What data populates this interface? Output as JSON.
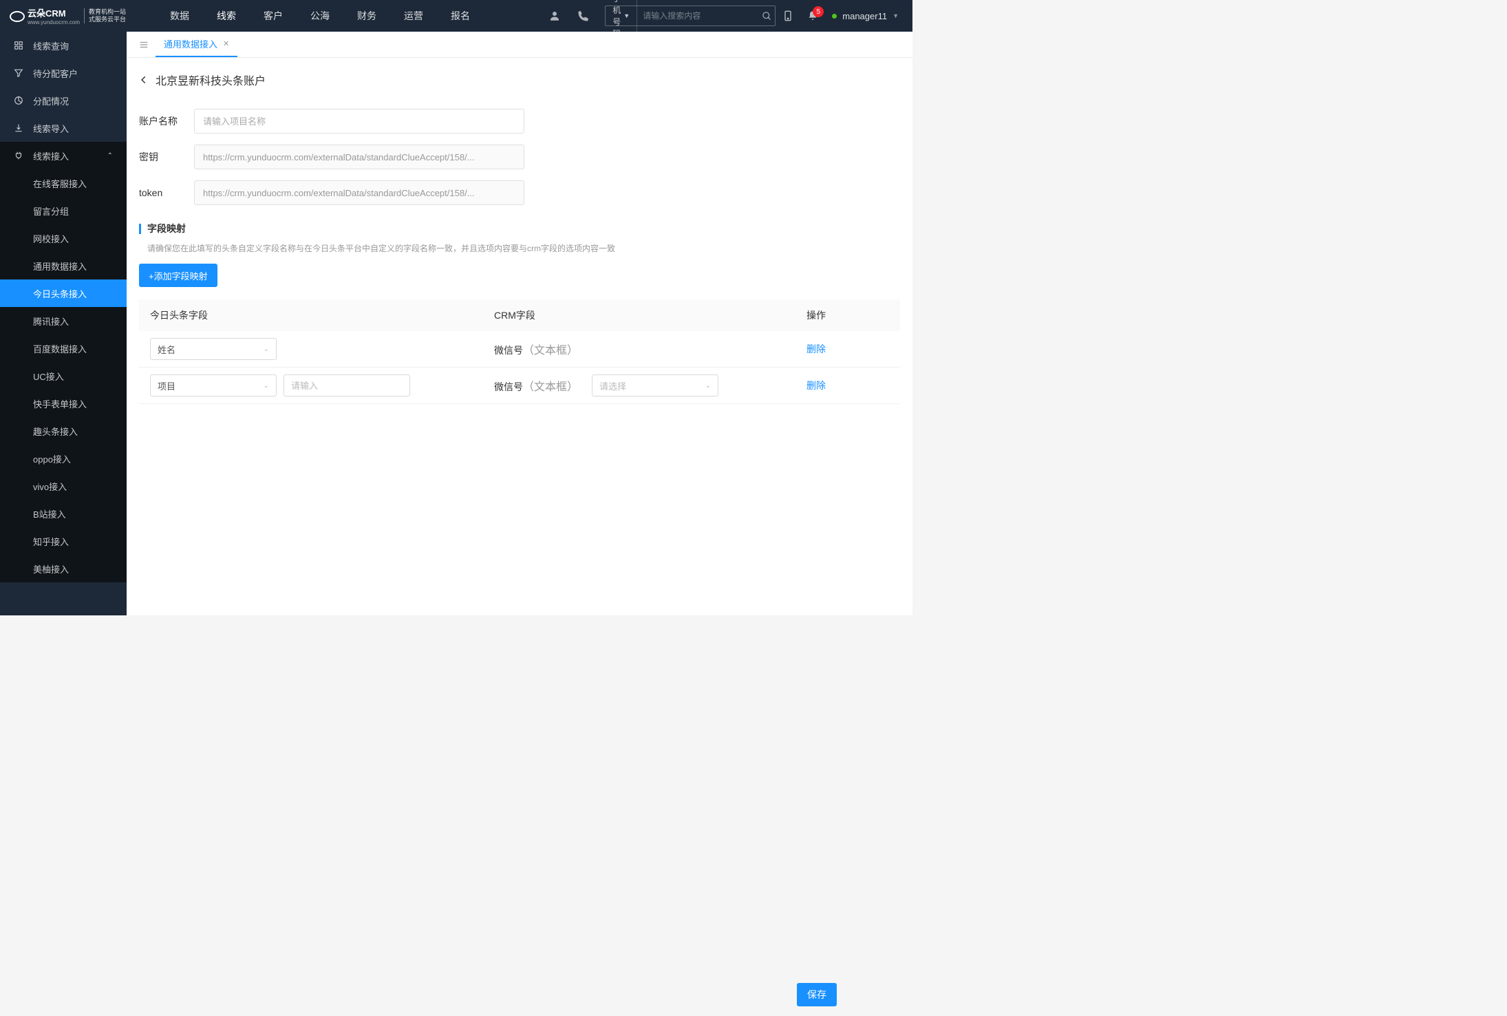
{
  "logo": {
    "brand": "云朵CRM",
    "subtitle1": "教育机构一站",
    "subtitle2": "式服务云平台",
    "url": "www.yunduocrm.com"
  },
  "topnav": [
    "数据",
    "线索",
    "客户",
    "公海",
    "财务",
    "运营",
    "报名"
  ],
  "topnav_active": 1,
  "search": {
    "selector": "手机号码",
    "placeholder": "请输入搜索内容"
  },
  "notifications": {
    "count": "5"
  },
  "user": {
    "name": "manager11"
  },
  "sidebar": {
    "items": [
      {
        "icon": "grid",
        "label": "线索查询"
      },
      {
        "icon": "filter",
        "label": "待分配客户"
      },
      {
        "icon": "pie",
        "label": "分配情况"
      },
      {
        "icon": "export",
        "label": "线索导入"
      }
    ],
    "expanded": {
      "icon": "plug",
      "label": "线索接入"
    },
    "subitems": [
      "在线客服接入",
      "留言分组",
      "网校接入",
      "通用数据接入",
      "今日头条接入",
      "腾讯接入",
      "百度数据接入",
      "UC接入",
      "快手表单接入",
      "趣头条接入",
      "oppo接入",
      "vivo接入",
      "B站接入",
      "知乎接入",
      "美柚接入"
    ],
    "active_sub": 4
  },
  "tab": {
    "label": "通用数据接入"
  },
  "page": {
    "title": "北京昱新科技头条账户"
  },
  "form": {
    "account_label": "账户名称",
    "account_placeholder": "请输入项目名称",
    "secret_label": "密钥",
    "secret_value": "https://crm.yunduocrm.com/externalData/standardClueAccept/158/...",
    "token_label": "token",
    "token_value": "https://crm.yunduocrm.com/externalData/standardClueAccept/158/..."
  },
  "mapping": {
    "title": "字段映射",
    "desc": "请确保您在此填写的头条自定义字段名称与在今日头条平台中自定义的字段名称一致，并且选项内容要与crm字段的选项内容一致",
    "add_button": "+添加字段映射",
    "columns": {
      "c1": "今日头条字段",
      "c2": "CRM字段",
      "c3": "操作"
    },
    "rows": [
      {
        "field": "姓名",
        "crm_name": "微信号",
        "crm_type": "（文本框）",
        "has_input": false,
        "has_select": false
      },
      {
        "field": "项目",
        "crm_name": "微信号",
        "crm_type": "（文本框）",
        "has_input": true,
        "input_ph": "请输入",
        "has_select": true,
        "select_ph": "请选择"
      }
    ],
    "delete_label": "删除"
  },
  "save_button": "保存"
}
